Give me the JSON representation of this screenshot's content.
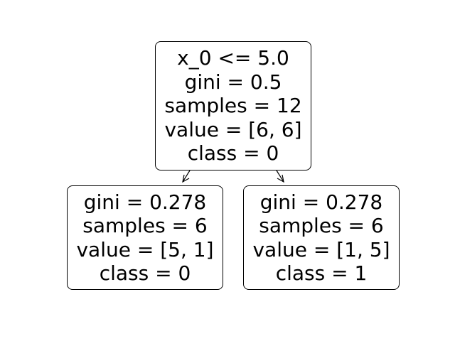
{
  "tree": {
    "root": {
      "split": "x_0 <= 5.0",
      "gini": "gini = 0.5",
      "samples": "samples = 12",
      "value": "value = [6, 6]",
      "class": "class = 0"
    },
    "left": {
      "gini": "gini = 0.278",
      "samples": "samples = 6",
      "value": "value = [5, 1]",
      "class": "class = 0"
    },
    "right": {
      "gini": "gini = 0.278",
      "samples": "samples = 6",
      "value": "value = [1, 5]",
      "class": "class = 1"
    }
  }
}
